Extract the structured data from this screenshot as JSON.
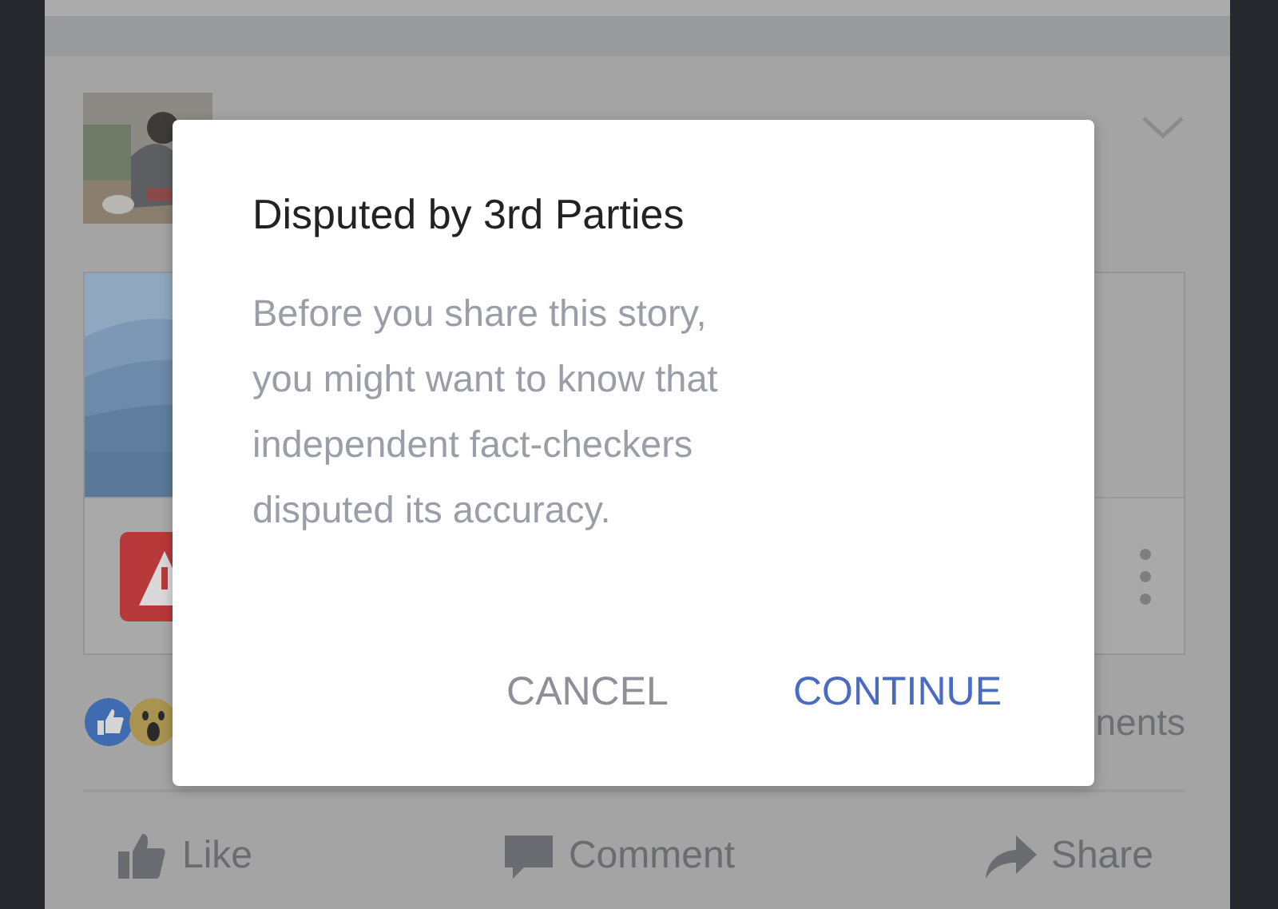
{
  "post": {
    "reactions_text": "nents",
    "actions": [
      {
        "label": "Like",
        "kind": "like"
      },
      {
        "label": "Comment",
        "kind": "comment"
      },
      {
        "label": "Share",
        "kind": "share"
      }
    ]
  },
  "dialog": {
    "title": "Disputed by 3rd Parties",
    "message": "Before you share this story,\nyou might want to know that\nindependent fact-checkers\ndisputed its accuracy.",
    "buttons": [
      {
        "label": "CANCEL",
        "kind": "secondary"
      },
      {
        "label": "CONTINUE",
        "kind": "primary"
      }
    ]
  }
}
